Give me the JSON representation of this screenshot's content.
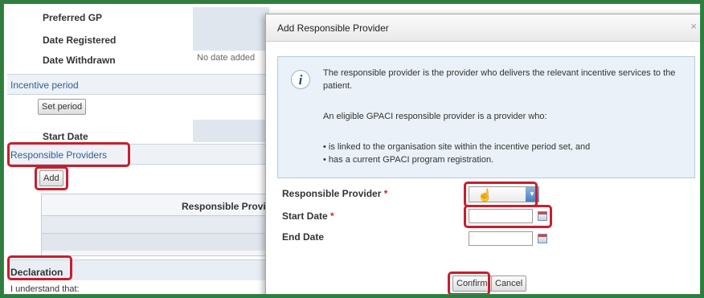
{
  "background_page": {
    "fields": [
      {
        "label": "Preferred GP",
        "value": ""
      },
      {
        "label": "Date Registered",
        "value": ""
      },
      {
        "label": "Date Withdrawn",
        "value": "No date added"
      }
    ],
    "incentive_section": "Incentive period",
    "set_period_button": "Set period",
    "start_date_label": "Start Date",
    "responsible_providers_section": "Responsible Providers",
    "add_button": "Add",
    "table_header": "Responsible Provide",
    "declaration_section": "Declaration",
    "understand_text": "I understand that:"
  },
  "modal": {
    "title": "Add Responsible Provider",
    "close_glyph": "×",
    "info_icon_glyph": "i",
    "info": {
      "paragraph1": "The responsible provider is the provider who delivers the relevant incentive services to the patient.",
      "paragraph2": "An eligible GPACI responsible provider is a provider who:",
      "bullet1": "• is linked to the organisation site within the incentive period set, and",
      "bullet2": "• has a current GPACI program registration."
    },
    "form": {
      "responsible_provider_label": "Responsible Provider",
      "start_date_label": "Start Date",
      "end_date_label": "End Date",
      "required_marker": "*",
      "responsible_provider_value": "",
      "start_date_value": "",
      "end_date_value": ""
    },
    "confirm_button": "Confirm",
    "cancel_button": "Cancel"
  },
  "colors": {
    "frame_border": "#2f7d3f",
    "highlight": "#c81e2d",
    "section_link": "#2f5d9a",
    "info_bg": "#eaf1f8",
    "required": "#d4242b"
  }
}
